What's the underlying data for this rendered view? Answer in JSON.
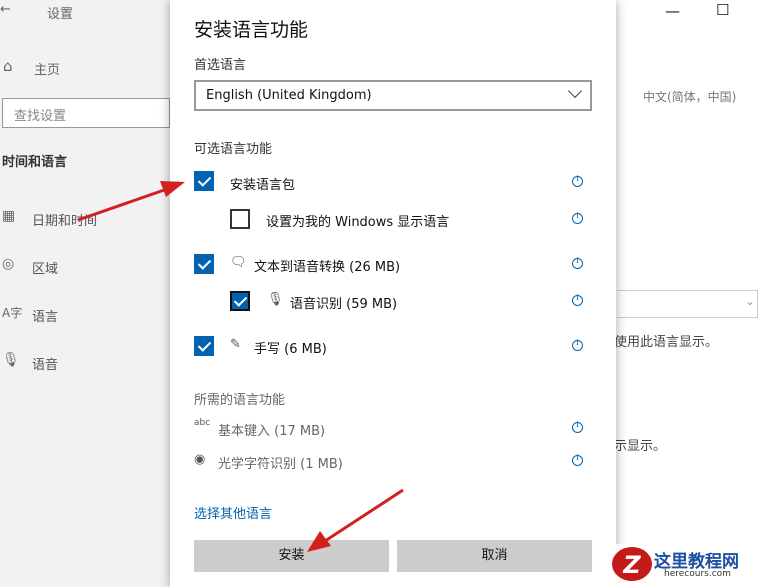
{
  "background": {
    "window_title": "设置",
    "back_glyph": "←",
    "home_label": "主页",
    "search_placeholder": "查找设置",
    "section_heading": "时间和语言",
    "nav_items": [
      {
        "label": "日期和时间",
        "icon": "calendar-clock-icon"
      },
      {
        "label": "区域",
        "icon": "globe-icon"
      },
      {
        "label": "语言",
        "icon": "language-icon"
      },
      {
        "label": "语音",
        "icon": "microphone-icon"
      }
    ],
    "right_lang_text": "中文(简体，中国)",
    "right_text_1": "使用此语言显示。",
    "right_text_2": "示显示。",
    "window_controls": {
      "minimize": "—",
      "maximize": "☐"
    }
  },
  "dialog": {
    "title": "安装语言功能",
    "preferred_label": "首选语言",
    "preferred_value": "English (United Kingdom)",
    "optional_heading": "可选语言功能",
    "features": [
      {
        "label": "安装语言包",
        "checked": true
      },
      {
        "label": "设置为我的 Windows 显示语言",
        "checked": false
      },
      {
        "label": "文本到语音转换 (26 MB)",
        "checked": true,
        "icon": "text-to-speech-icon"
      },
      {
        "label": "语音识别 (59 MB)",
        "checked": true,
        "icon": "microphone-icon"
      },
      {
        "label": "手写 (6 MB)",
        "checked": true,
        "icon": "pen-icon"
      }
    ],
    "required_heading": "所需的语言功能",
    "required": [
      {
        "label": "基本键入 (17 MB)",
        "icon": "abc-icon"
      },
      {
        "label": "光学字符识别 (1 MB)",
        "icon": "camera-icon"
      }
    ],
    "other_link": "选择其他语言",
    "install_button": "安装",
    "cancel_button": "取消"
  },
  "watermark": {
    "badge": "Z",
    "name": "这里教程网",
    "url": "herecours.com"
  },
  "colors": {
    "accent": "#0063b1",
    "arrow": "#d41f1f",
    "button": "#cccccc"
  }
}
